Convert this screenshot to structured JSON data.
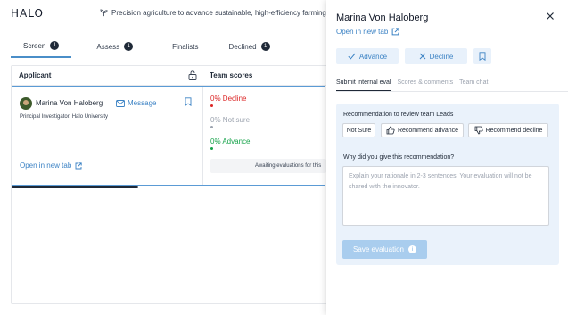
{
  "app": {
    "logo": "HALO",
    "challenge_title": "Precision agriculture to advance sustainable, high-efficiency farming"
  },
  "tabs": [
    {
      "label": "Screen",
      "count": "1"
    },
    {
      "label": "Assess",
      "count": "1"
    },
    {
      "label": "Finalists"
    },
    {
      "label": "Declined",
      "count": "1"
    }
  ],
  "board": {
    "applicant_header": "Applicant",
    "scores_header": "Team scores",
    "applicant": {
      "name": "Marina Von Haloberg",
      "message_label": "Message",
      "role": "Principal Investigator, Halo University",
      "open_tab": "Open in new tab"
    },
    "scores": {
      "decline": "0% Decline",
      "not_sure": "0% Not sure",
      "advance": "0% Advance",
      "awaiting": "Awaiting evaluations for this"
    }
  },
  "panel": {
    "title": "Marina Von Haloberg",
    "open_tab": "Open in new tab",
    "advance": "Advance",
    "decline": "Decline",
    "tabs": [
      "Submit internal eval",
      "Scores & comments",
      "Team chat"
    ],
    "rec_label": "Recommendation to review team Leads",
    "rec_not_sure": "Not Sure",
    "rec_advance": "Recommend advance",
    "rec_decline": "Recommend decline",
    "why_label": "Why did you give this recommendation?",
    "rationale_placeholder": "Explain your rationale in 2-3 sentences. Your evaluation will not be shared with the innovator.",
    "save": "Save evaluation"
  },
  "colors": {
    "accent": "#3b82c4",
    "decline": "#dc2626",
    "advance": "#16a34a",
    "neutral": "#9ca3af"
  }
}
